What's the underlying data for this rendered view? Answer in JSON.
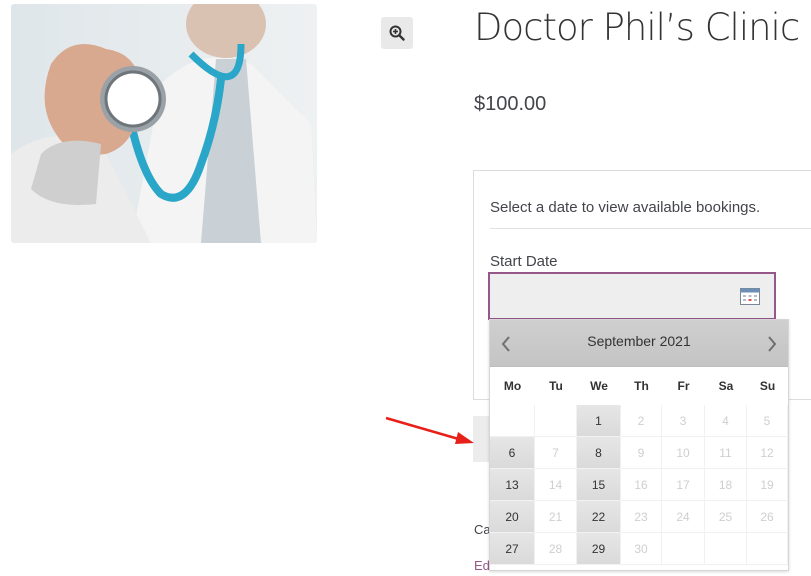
{
  "product": {
    "title": "Doctor Phil’s Clinic",
    "price": "$100.00",
    "image_alt": "doctor-with-stethoscope"
  },
  "booking": {
    "message": "Select a date to view available bookings.",
    "start_date_label": "Start Date",
    "start_date_value": ""
  },
  "meta": {
    "category_prefix": "Cat",
    "edit_link": "Edit"
  },
  "datepicker": {
    "month_label": "September 2021",
    "weekdays": [
      "Mo",
      "Tu",
      "We",
      "Th",
      "Fr",
      "Sa",
      "Su"
    ],
    "weeks": [
      [
        {
          "d": "",
          "a": false
        },
        {
          "d": "",
          "a": false
        },
        {
          "d": "1",
          "a": true
        },
        {
          "d": "2",
          "a": false
        },
        {
          "d": "3",
          "a": false
        },
        {
          "d": "4",
          "a": false
        },
        {
          "d": "5",
          "a": false
        }
      ],
      [
        {
          "d": "6",
          "a": true
        },
        {
          "d": "7",
          "a": false
        },
        {
          "d": "8",
          "a": true
        },
        {
          "d": "9",
          "a": false
        },
        {
          "d": "10",
          "a": false
        },
        {
          "d": "11",
          "a": false
        },
        {
          "d": "12",
          "a": false
        }
      ],
      [
        {
          "d": "13",
          "a": true
        },
        {
          "d": "14",
          "a": false
        },
        {
          "d": "15",
          "a": true
        },
        {
          "d": "16",
          "a": false
        },
        {
          "d": "17",
          "a": false
        },
        {
          "d": "18",
          "a": false
        },
        {
          "d": "19",
          "a": false
        }
      ],
      [
        {
          "d": "20",
          "a": true
        },
        {
          "d": "21",
          "a": false
        },
        {
          "d": "22",
          "a": true
        },
        {
          "d": "23",
          "a": false
        },
        {
          "d": "24",
          "a": false
        },
        {
          "d": "25",
          "a": false
        },
        {
          "d": "26",
          "a": false
        }
      ],
      [
        {
          "d": "27",
          "a": true
        },
        {
          "d": "28",
          "a": false
        },
        {
          "d": "29",
          "a": true
        },
        {
          "d": "30",
          "a": false
        },
        {
          "d": "",
          "a": false
        },
        {
          "d": "",
          "a": false
        },
        {
          "d": "",
          "a": false
        }
      ]
    ]
  },
  "colors": {
    "accent": "#96588a",
    "annotation_arrow": "#e8201a"
  },
  "icons": {
    "zoom": "zoom-in-icon",
    "calendar": "calendar-icon",
    "prev": "chevron-left-icon",
    "next": "chevron-right-icon"
  }
}
